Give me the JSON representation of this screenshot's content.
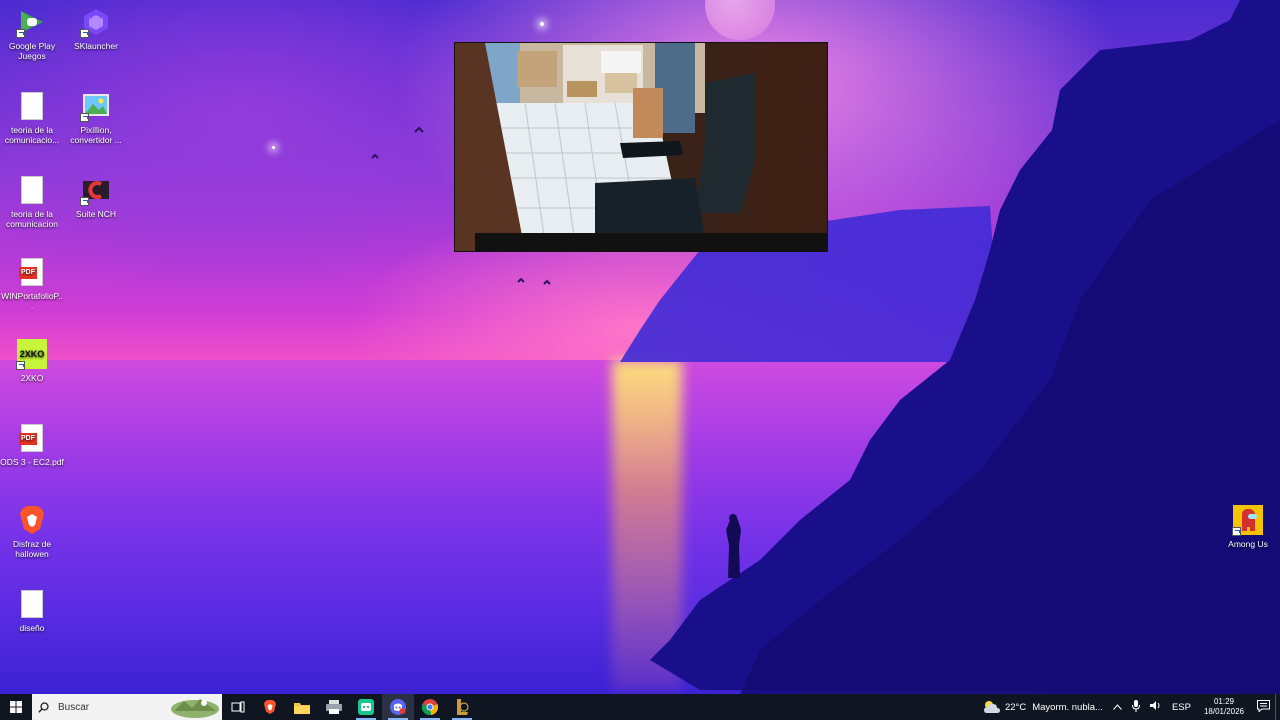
{
  "desktop_icons": [
    {
      "label": "Google Play Juegos",
      "icon": "google-play-games-icon"
    },
    {
      "label": "SKlauncher",
      "icon": "sklauncher-icon"
    },
    {
      "label": "teoria de la comunicacio...",
      "icon": "text-document-icon"
    },
    {
      "label": "Pixillion, convertidor ...",
      "icon": "pixillion-icon"
    },
    {
      "label": "teoria de la comunicacion",
      "icon": "text-document-icon"
    },
    {
      "label": "Suite NCH",
      "icon": "nch-suite-icon"
    },
    {
      "label": "WINPortafolioP...",
      "icon": "pdf-icon"
    },
    {
      "label": "2XKO",
      "icon": "2xko-icon"
    },
    {
      "label": "ODS 3 - EC2.pdf",
      "icon": "pdf-icon"
    },
    {
      "label": "Disfraz de hallowen",
      "icon": "brave-icon"
    },
    {
      "label": "diseño",
      "icon": "text-document-icon"
    },
    {
      "label": "Among Us",
      "icon": "among-us-icon"
    }
  ],
  "pdf_badge": "PDF",
  "game_badge": "2XKO",
  "taskbar": {
    "search_placeholder": "Buscar",
    "apps": [
      "task-view-icon",
      "brave-icon",
      "file-explorer-icon",
      "printer-icon",
      "nch-app-icon",
      "discord-icon",
      "chrome-icon",
      "league-icon"
    ]
  },
  "tray": {
    "temperature": "22°C",
    "weather": "Mayorm. nubla...",
    "language": "ESP",
    "time": "01:29",
    "date": "18/01/2026"
  },
  "colors": {
    "taskbar": "#101522",
    "accent": "#8ab4f8"
  }
}
